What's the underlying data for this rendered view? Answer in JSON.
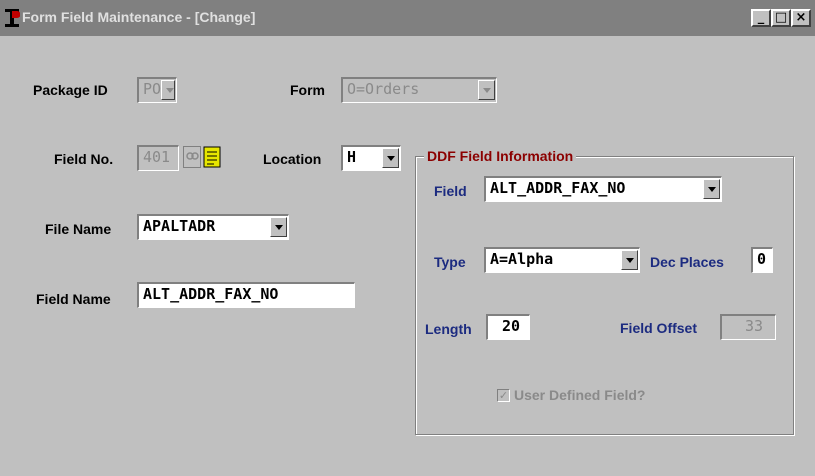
{
  "window": {
    "title": "Form Field Maintenance - [Change]",
    "controls": {
      "minimize": "_",
      "maximize": "□",
      "close": "×"
    }
  },
  "form": {
    "package_id": {
      "label": "Package ID",
      "value": "PO"
    },
    "form": {
      "label": "Form",
      "value": "O=Orders"
    },
    "field_no": {
      "label": "Field No.",
      "value": "401"
    },
    "location": {
      "label": "Location",
      "value": "H"
    },
    "file_name": {
      "label": "File Name",
      "value": "APALTADR"
    },
    "field_name": {
      "label": "Field Name",
      "value": "ALT_ADDR_FAX_NO"
    }
  },
  "ddf": {
    "title": "DDF Field Information",
    "field": {
      "label": "Field",
      "value": "ALT_ADDR_FAX_NO"
    },
    "type": {
      "label": "Type",
      "value": "A=Alpha"
    },
    "dec_places": {
      "label": "Dec Places",
      "value": "0"
    },
    "length": {
      "label": "Length",
      "value": "20"
    },
    "field_offset": {
      "label": "Field Offset",
      "value": "33"
    },
    "user_defined": {
      "label": "User Defined Field?",
      "checked": true,
      "check_glyph": "✓"
    }
  },
  "colors": {
    "titlebar": "#808080",
    "group_title": "#8b0000",
    "label_blue": "#1c2b80",
    "disabled": "#8a8a8a"
  },
  "icons": [
    "app-icon",
    "lookup-icon",
    "memo-icon",
    "dropdown-arrow-icon"
  ]
}
